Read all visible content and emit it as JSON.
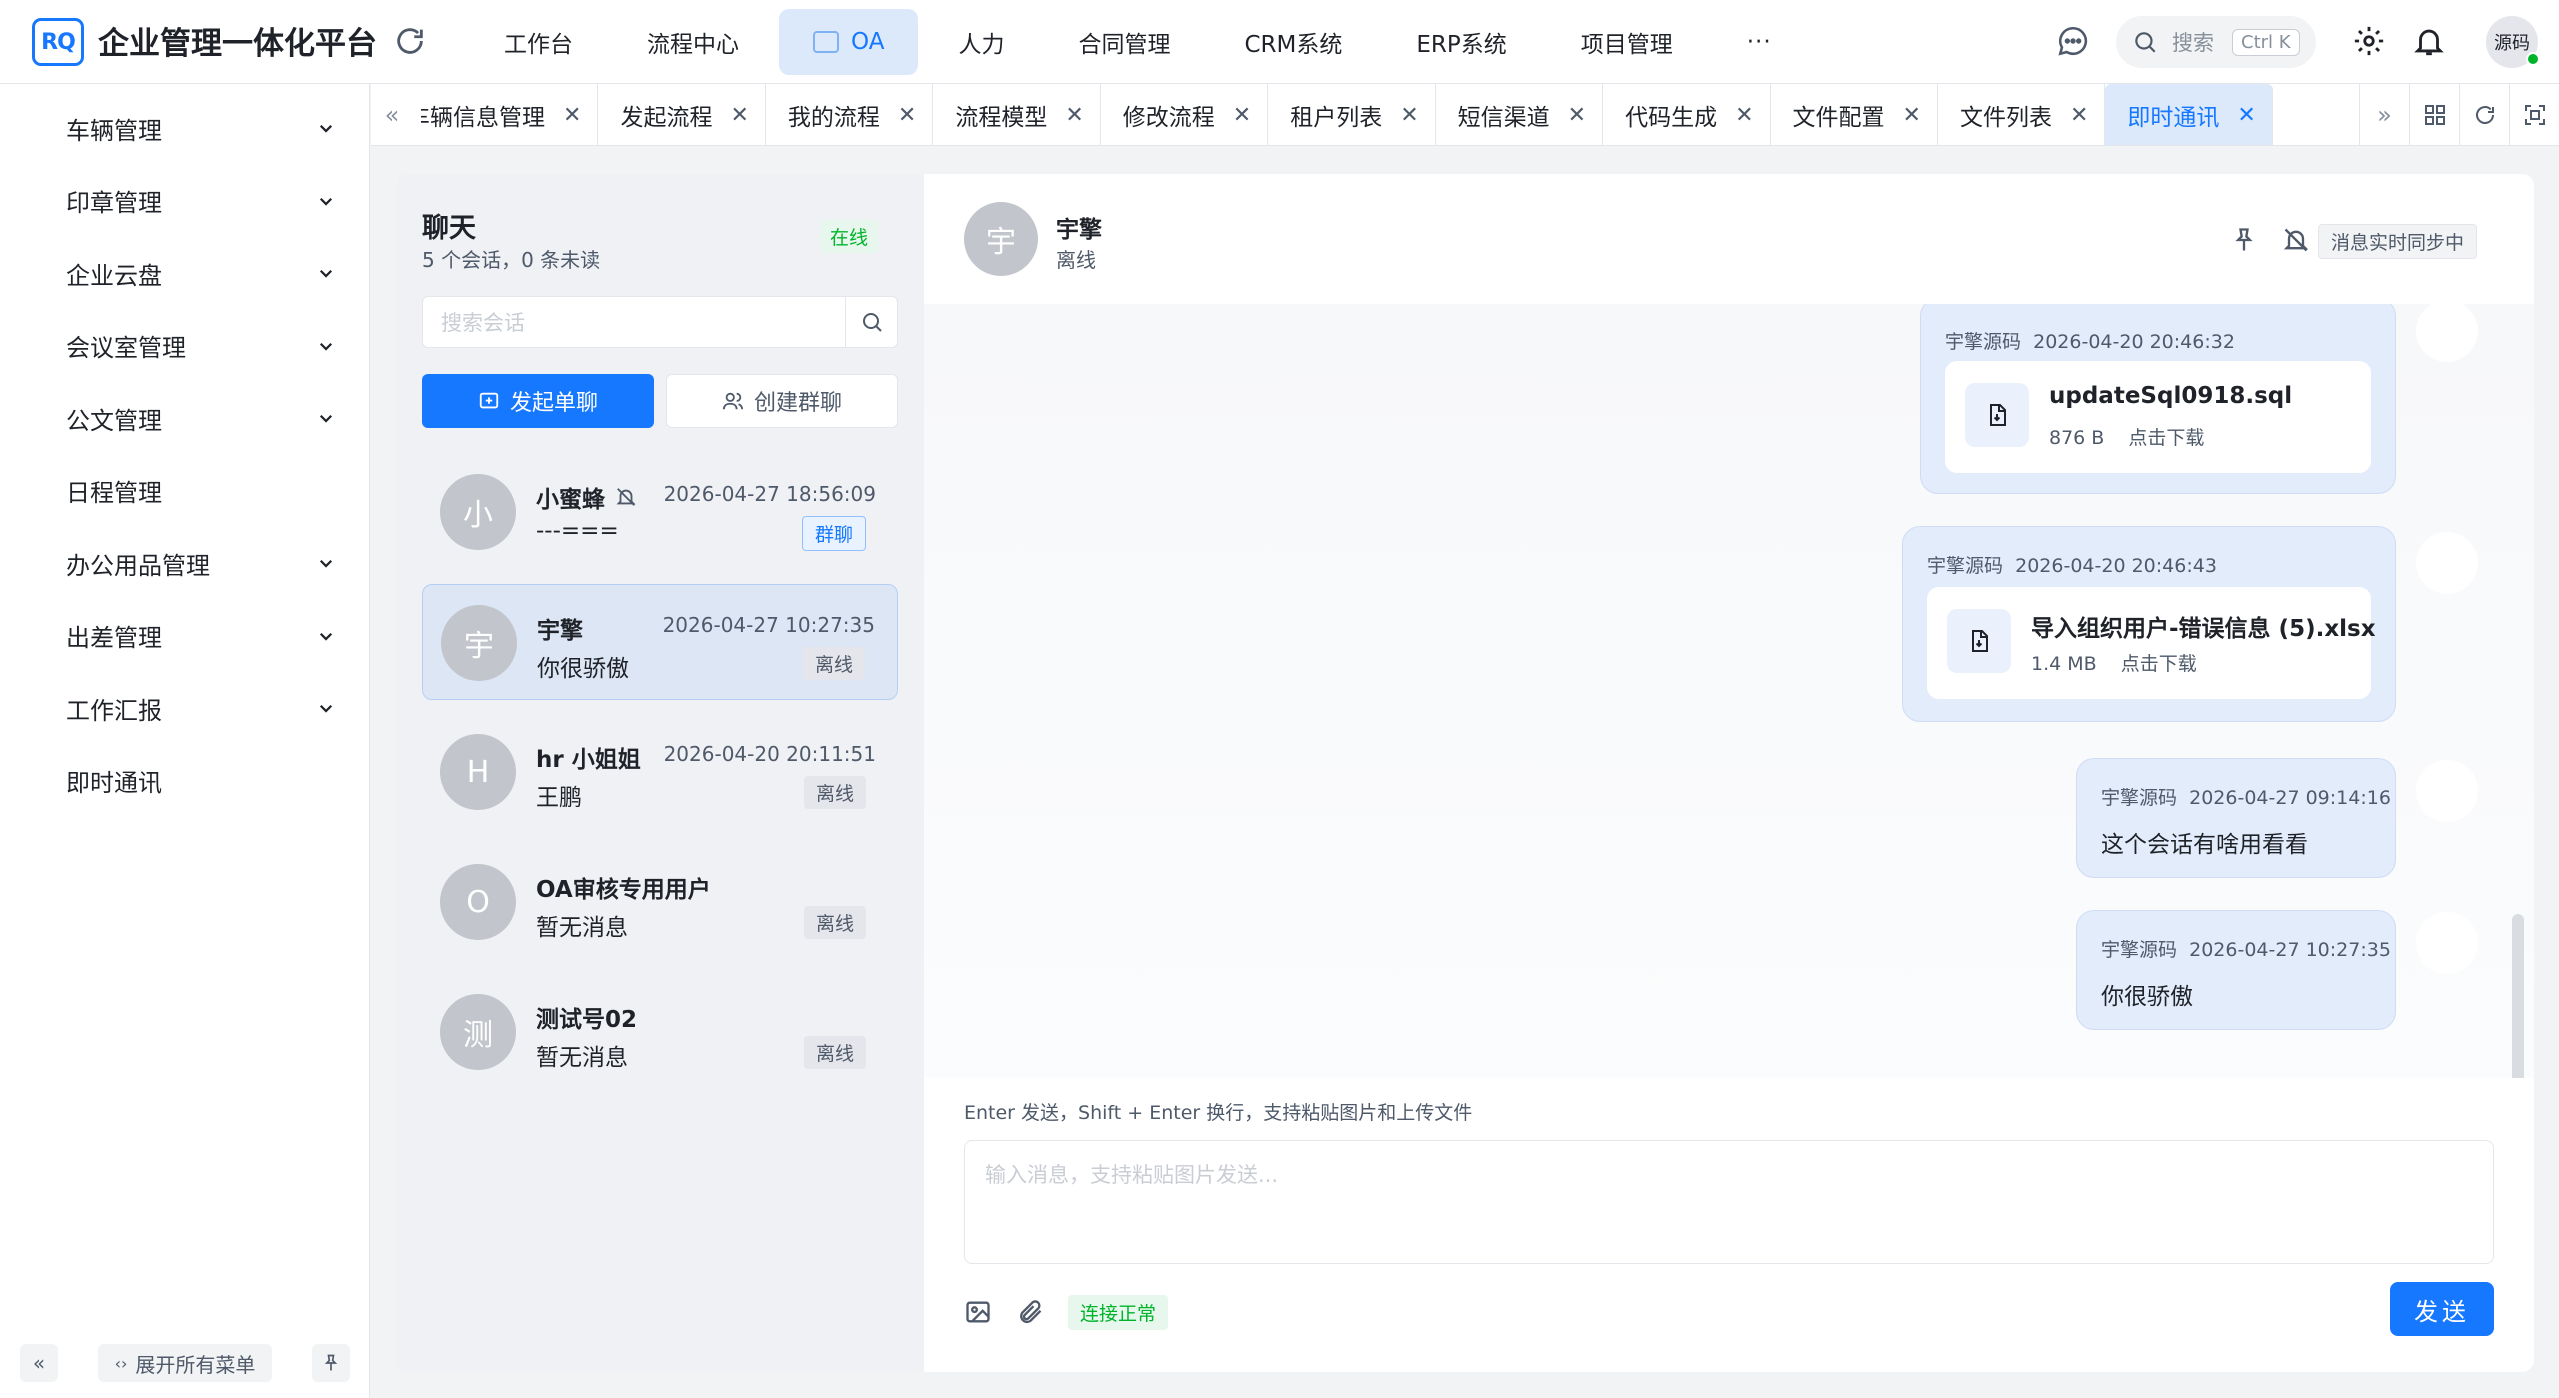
{
  "header": {
    "logo_text": "RQ",
    "app_title": "企业管理一体化平台",
    "nav": [
      "工作台",
      "流程中心",
      "OA",
      "人力",
      "合同管理",
      "CRM系统",
      "ERP系统",
      "项目管理"
    ],
    "more": "···",
    "search_placeholder": "搜索",
    "search_shortcut": "Ctrl K",
    "user_name": "源码",
    "accent_color": "#1677ff"
  },
  "sidebar": {
    "items": [
      {
        "label": "车辆管理",
        "expandable": true
      },
      {
        "label": "印章管理",
        "expandable": true
      },
      {
        "label": "企业云盘",
        "expandable": true
      },
      {
        "label": "会议室管理",
        "expandable": true
      },
      {
        "label": "公文管理",
        "expandable": true
      },
      {
        "label": "日程管理",
        "expandable": false
      },
      {
        "label": "办公用品管理",
        "expandable": true
      },
      {
        "label": "出差管理",
        "expandable": true
      },
      {
        "label": "工作汇报",
        "expandable": true
      },
      {
        "label": "即时通讯",
        "expandable": false
      }
    ],
    "collapse_icon": "«",
    "expand_all": "展开所有菜单"
  },
  "tabs": {
    "items": [
      "车辆信息管理",
      "发起流程",
      "我的流程",
      "流程模型",
      "修改流程",
      "租户列表",
      "短信渠道",
      "代码生成",
      "文件配置",
      "文件列表",
      "即时通讯"
    ],
    "active": "即时通讯"
  },
  "chat_list": {
    "title": "聊天",
    "subtitle": "5 个会话，0 条未读",
    "status": "在线",
    "search_placeholder": "搜索会话",
    "new_single": "发起单聊",
    "new_group": "创建群聊",
    "conversations": [
      {
        "avatar": "小",
        "name": "小蜜蜂",
        "muted": true,
        "time": "2026-04-27 18:56:09",
        "last": "---===",
        "tag": "群聊",
        "group": true
      },
      {
        "avatar": "宇",
        "name": "宇擎",
        "muted": false,
        "time": "2026-04-27 10:27:35",
        "last": "你很骄傲",
        "tag": "离线",
        "group": false
      },
      {
        "avatar": "H",
        "name": "hr 小姐姐",
        "muted": false,
        "time": "2026-04-20 20:11:51",
        "last": "王鹏",
        "tag": "离线",
        "group": false
      },
      {
        "avatar": "O",
        "name": "OA审核专用用户",
        "muted": false,
        "time": "",
        "last": "暂无消息",
        "tag": "离线",
        "group": false
      },
      {
        "avatar": "测",
        "name": "测试号02",
        "muted": false,
        "time": "",
        "last": "暂无消息",
        "tag": "离线",
        "group": false
      }
    ]
  },
  "chat": {
    "peer_avatar": "宇",
    "peer_name": "宇擎",
    "peer_status": "离线",
    "sync_status": "消息实时同步中",
    "messages": [
      {
        "sender": "宇擎源码",
        "time": "2026-04-20 20:46:32",
        "type": "file",
        "file_name": "updateSql0918.sql",
        "file_size": "876 B",
        "action": "点击下载"
      },
      {
        "sender": "宇擎源码",
        "time": "2026-04-20 20:46:43",
        "type": "file",
        "file_name": "导入组织用户-错误信息 (5).xlsx",
        "file_size": "1.4 MB",
        "action": "点击下载"
      },
      {
        "sender": "宇擎源码",
        "time": "2026-04-27 09:14:16",
        "type": "text",
        "text": "这个会话有啥用看看"
      },
      {
        "sender": "宇擎源码",
        "time": "2026-04-27 10:27:35",
        "type": "text",
        "text": "你很骄傲"
      }
    ],
    "hint": "Enter 发送，Shift + Enter 换行，支持粘贴图片和上传文件",
    "input_placeholder": "输入消息，支持粘贴图片发送...",
    "connection": "连接正常",
    "send": "发送"
  }
}
